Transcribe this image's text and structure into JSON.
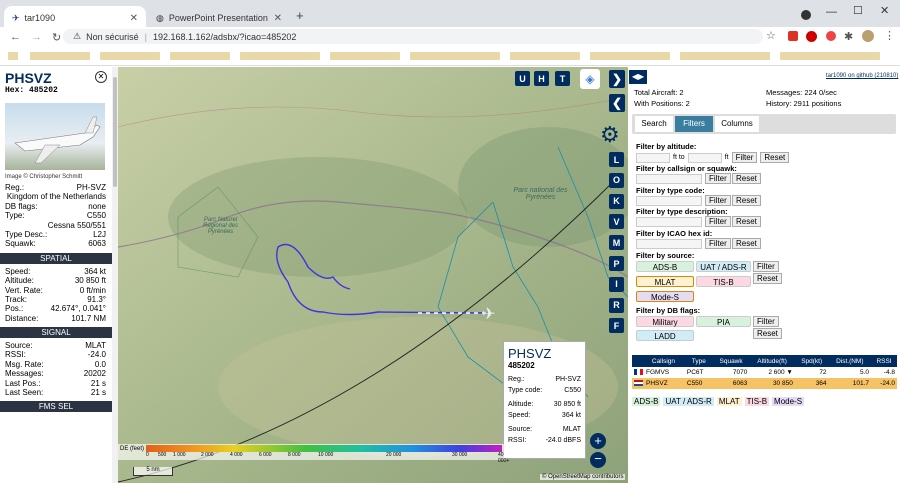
{
  "browser": {
    "tab1": "tar1090",
    "tab2": "PowerPoint Presentation",
    "not_secure": "Non sécurisé",
    "url": "192.168.1.162/adsbx/?icao=485202"
  },
  "left": {
    "callsign": "PHSVZ",
    "hex_label": "Hex:",
    "hex": "485202",
    "image_credit": "Image © Christopher Schmitt",
    "info": [
      [
        "Reg.:",
        "PH-SVZ"
      ],
      [
        "",
        "Kingdom of the Netherlands"
      ],
      [
        "DB flags:",
        "none"
      ],
      [
        "Type:",
        "C550"
      ],
      [
        "",
        "Cessna 550/551"
      ],
      [
        "Type Desc.:",
        "L2J"
      ],
      [
        "Squawk:",
        "6063"
      ]
    ],
    "spatial_title": "SPATIAL",
    "spatial": [
      [
        "Speed:",
        "364 kt"
      ],
      [
        "Altitude:",
        "30 850 ft"
      ],
      [
        "Vert. Rate:",
        "0 ft/min"
      ],
      [
        "Track:",
        "91.3°"
      ],
      [
        "Pos.:",
        "42.674°, 0.041°"
      ],
      [
        "Distance:",
        "101.7 NM"
      ]
    ],
    "signal_title": "SIGNAL",
    "signal": [
      [
        "Source:",
        "MLAT"
      ],
      [
        "RSSI:",
        "-24.0"
      ],
      [
        "Msg. Rate:",
        "0.0"
      ],
      [
        "Messages:",
        "20202"
      ],
      [
        "Last Pos.:",
        "21 s"
      ],
      [
        "Last Seen:",
        "21 s"
      ]
    ],
    "fms_title": "FMS SEL"
  },
  "map": {
    "buttons_top": [
      "U",
      "H",
      "T"
    ],
    "buttons_side": [
      "L",
      "O",
      "K",
      "V",
      "M",
      "P",
      "I",
      "R",
      "F"
    ],
    "label_park": "Parc national des Pyrénées",
    "label_pnr": "Parc Naturel Régional des Pyrénées",
    "scale": "5 nm",
    "osm": "© OpenStreetMap contributors",
    "alt_label": "DE (feet)",
    "alt_ticks": [
      "0",
      "500",
      "1 000",
      "2 000",
      "4 000",
      "6 000",
      "8 000",
      "10 000",
      "20 000",
      "30 000",
      "40 000+"
    ],
    "popup": {
      "callsign": "PHSVZ",
      "hex": "485202",
      "rows": [
        [
          "Reg.:",
          "PH-SVZ"
        ],
        [
          "Type code:",
          "C550"
        ],
        [
          "Altitude:",
          "30 850 ft"
        ],
        [
          "Speed:",
          "364 kt"
        ],
        [
          "Source:",
          "MLAT"
        ],
        [
          "RSSI:",
          "-24.0 dBFS"
        ]
      ]
    }
  },
  "right": {
    "github": "tar1090 on github (210810)",
    "total_aircraft": "Total Aircraft: 2",
    "with_positions": "With Positions: 2",
    "messages": "Messages: 224 0/sec",
    "history": "History: 2911 positions",
    "tabs": [
      "Search",
      "Filters",
      "Columns"
    ],
    "f_alt": "Filter by altitude:",
    "ft_to": "ft to",
    "ft": "ft",
    "filter": "Filter",
    "reset": "Reset",
    "f_callsign": "Filter by callsign or squawk:",
    "f_type": "Filter by type code:",
    "f_desc": "Filter by type description:",
    "f_icao": "Filter by ICAO hex id:",
    "f_source": "Filter by source:",
    "f_db": "Filter by DB flags:",
    "sources": [
      "ADS-B",
      "UAT / ADS-R",
      "MLAT",
      "TIS-B",
      "Mode-S"
    ],
    "db": [
      "Military",
      "PIA",
      "LADD"
    ],
    "table_headers": [
      "Callsign",
      "Type",
      "Squawk",
      "Altitude(ft)",
      "Spd(kt)",
      "Dist.(NM)",
      "RSSI"
    ],
    "rows": [
      [
        "FGMVS",
        "PC6T",
        "7070",
        "2 600 ▼",
        "72",
        "5.0",
        "-4.8"
      ],
      [
        "PHSVZ",
        "C550",
        "6063",
        "30 850",
        "364",
        "101.7",
        "-24.0"
      ]
    ],
    "legend": [
      "ADS-B",
      "UAT / ADS-R",
      "MLAT",
      "TIS-B",
      "Mode-S"
    ]
  }
}
